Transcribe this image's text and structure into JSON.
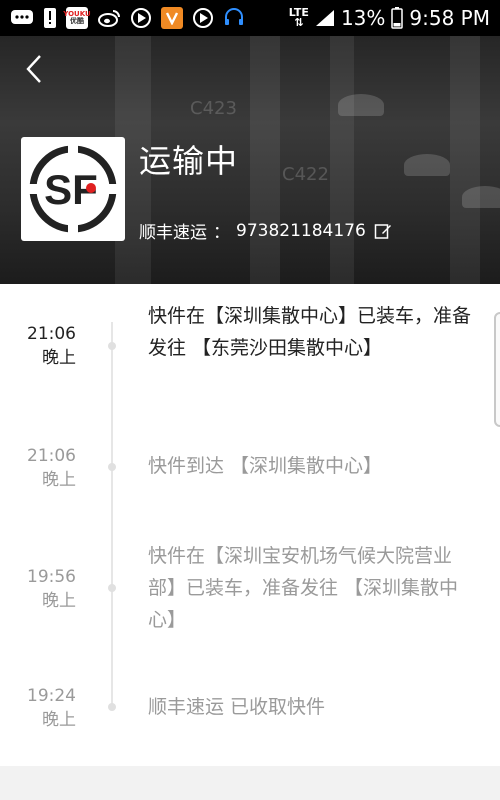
{
  "status_bar": {
    "left_icons": [
      "chat-icon",
      "alert-icon",
      "youku-app-icon",
      "weibo-icon",
      "play-icon",
      "iqiyi-app-icon",
      "video-icon",
      "headset-icon"
    ],
    "youku_text_1": "YOUKU",
    "youku_text_2": "优酷",
    "network": "LTE",
    "battery_percent": "13%",
    "time": "9:58 PM"
  },
  "header": {
    "back_icon": "chevron-left-icon",
    "logo_text": "SF",
    "status": "运输中",
    "carrier": "顺丰速运",
    "separator": "：",
    "tracking_number": "973821184176",
    "background_signs": [
      "C423",
      "C422"
    ]
  },
  "timeline": {
    "events": [
      {
        "time": "21:06",
        "period": "晚上",
        "description": "快件在【深圳集散中心】已装车，准备发往 【东莞沙田集散中心】"
      },
      {
        "time": "21:06",
        "period": "晚上",
        "description": "快件到达 【深圳集散中心】"
      },
      {
        "time": "19:56",
        "period": "晚上",
        "description": "快件在【深圳宝安机场气候大院营业部】已装车，准备发往 【深圳集散中心】"
      },
      {
        "time": "19:24",
        "period": "晚上",
        "description": "顺丰速运 已收取快件"
      }
    ]
  },
  "colors": {
    "sf_red": "#e02020",
    "logo_black": "#222222",
    "header_bg": "#2c2c2c",
    "latest_text": "#222222",
    "older_text": "#9a9a9a"
  }
}
